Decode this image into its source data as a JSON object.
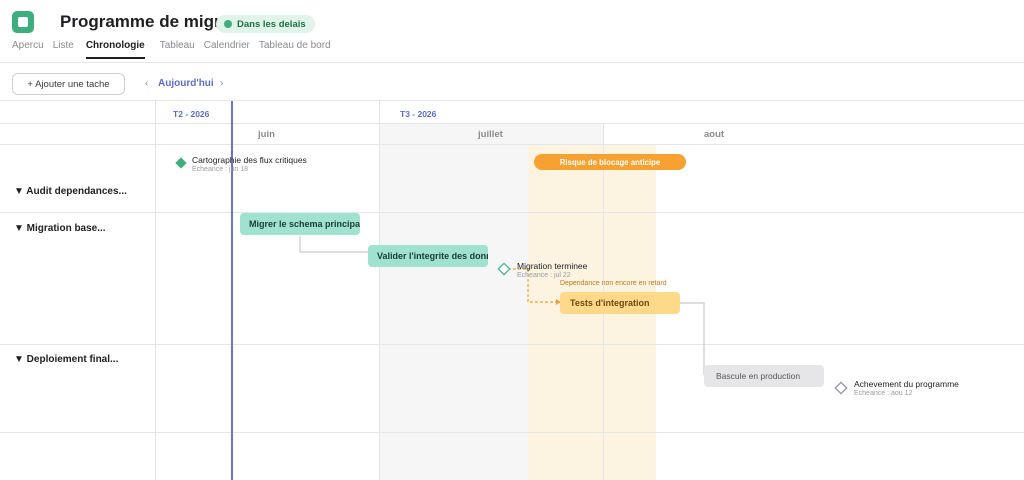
{
  "header": {
    "title": "Programme de migratic",
    "status": "Dans les delais",
    "status_color": "#3fae7e"
  },
  "tabs": [
    {
      "label": "Apercu"
    },
    {
      "label": "Liste"
    },
    {
      "label": "Chronologie",
      "active": true
    },
    {
      "label": "Tableau"
    },
    {
      "label": "Calendrier"
    },
    {
      "label": "Tableau de bord"
    }
  ],
  "toolbar": {
    "add_task": "+ Ajouter une tache",
    "prev": "‹",
    "today": "Aujourd'hui",
    "next": "›"
  },
  "timeline": {
    "quarters": [
      "T2 - 2026",
      "T3 - 2026"
    ],
    "months": [
      "juin",
      "juillet",
      "aout"
    ],
    "today_color": "#6b73c9"
  },
  "sections": [
    {
      "label": "▼ Audit dependances..."
    },
    {
      "label": "▼ Migration base..."
    },
    {
      "label": "▼ Deploiement final..."
    }
  ],
  "milestones": {
    "cartographie": {
      "title": "Cartographie des flux critiques",
      "due": "Echeance : jun 18"
    },
    "migration_done": {
      "title": "Migration terminee",
      "due": "Echeance : jul 22"
    },
    "achievement": {
      "title": "Achevement du programme",
      "due": "Echeance : aou 12"
    }
  },
  "tasks": {
    "risk": "Risque de blocage anticipe",
    "schema": "Migrer le schema principal",
    "integrity": "Valider l'integrite des donnees",
    "tests": "Tests d'integration",
    "cutover": "Bascule en production"
  },
  "dependency_note": "Dependance non encore en retard",
  "colors": {
    "green_task": "#9fe2cf",
    "yellow_task": "#ffd98a",
    "risk": "#f7a230",
    "grey_task": "#e6e6e8"
  }
}
